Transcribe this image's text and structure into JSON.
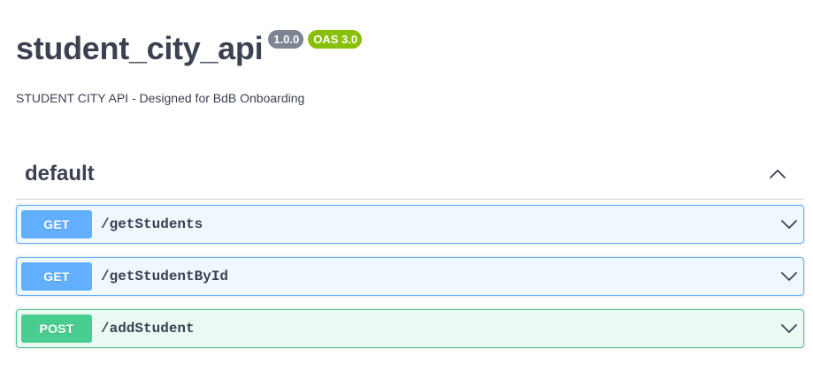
{
  "info": {
    "title": "student_city_api",
    "version_badge": "1.0.0",
    "oas_badge": "OAS 3.0",
    "description": "STUDENT CITY API - Designed for BdB Onboarding"
  },
  "tag": {
    "name": "default",
    "toggle_icon": "chevron-up-icon"
  },
  "operations": [
    {
      "method": "GET",
      "path": "/getStudents",
      "expand_icon": "chevron-down-icon"
    },
    {
      "method": "GET",
      "path": "/getStudentById",
      "expand_icon": "chevron-down-icon"
    },
    {
      "method": "POST",
      "path": "/addStudent",
      "expand_icon": "chevron-down-icon"
    }
  ],
  "colors": {
    "text": "#3b4151",
    "get": "#61affe",
    "post": "#49cc90",
    "version_badge": "#7d8492",
    "oas_badge": "#89bf04"
  }
}
